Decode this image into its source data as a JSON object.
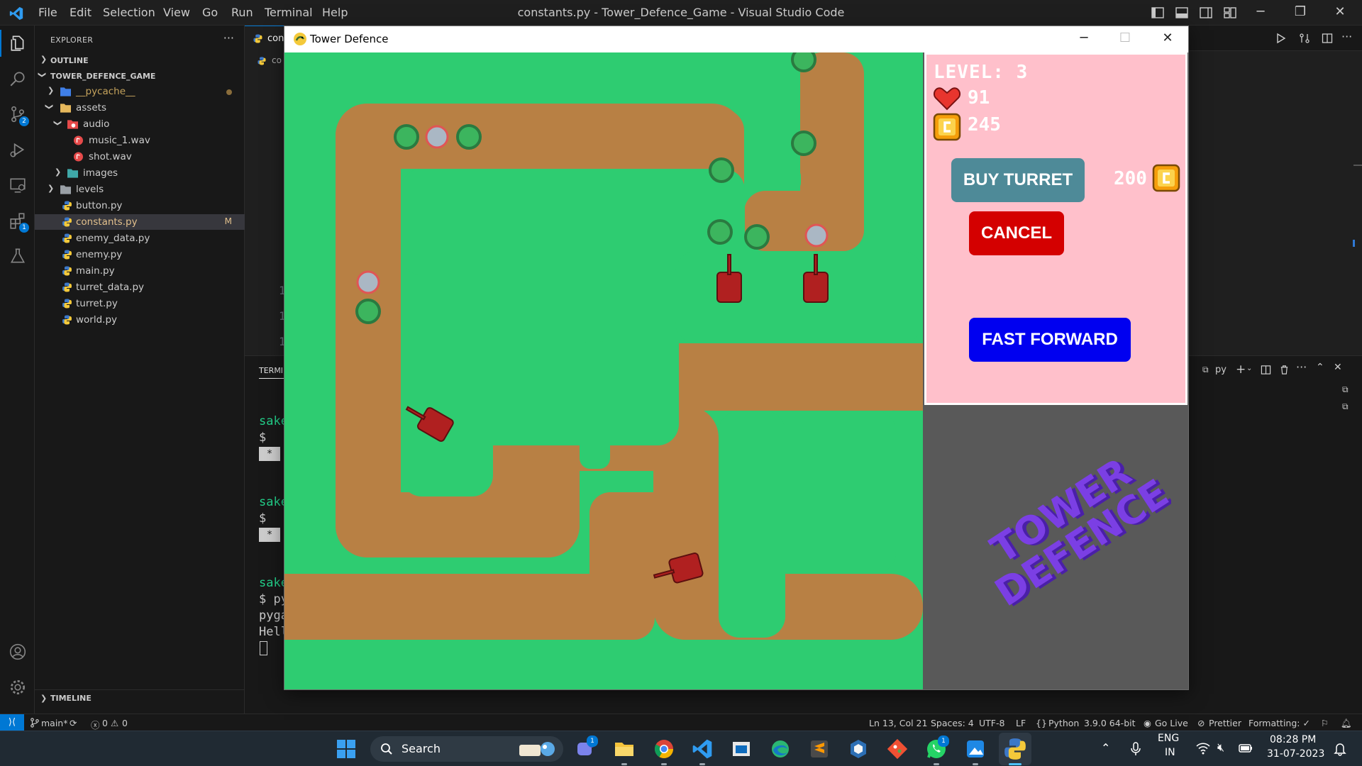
{
  "vscode": {
    "menu": [
      "File",
      "Edit",
      "Selection",
      "View",
      "Go",
      "Run",
      "Terminal",
      "Help"
    ],
    "window_title": "constants.py - Tower_Defence_Game - Visual Studio Code",
    "explorer": {
      "title": "EXPLORER",
      "outline": "OUTLINE",
      "project": "TOWER_DEFENCE_GAME",
      "timeline": "TIMELINE",
      "items": [
        {
          "label": "__pycache__",
          "type": "folder",
          "modified": true
        },
        {
          "label": "assets",
          "type": "folder"
        },
        {
          "label": "audio",
          "type": "folder"
        },
        {
          "label": "music_1.wav",
          "type": "audio"
        },
        {
          "label": "shot.wav",
          "type": "audio"
        },
        {
          "label": "images",
          "type": "folder"
        },
        {
          "label": "levels",
          "type": "folder"
        },
        {
          "label": "button.py",
          "type": "python"
        },
        {
          "label": "constants.py",
          "type": "python",
          "status": "M"
        },
        {
          "label": "enemy_data.py",
          "type": "python"
        },
        {
          "label": "enemy.py",
          "type": "python"
        },
        {
          "label": "main.py",
          "type": "python"
        },
        {
          "label": "turret_data.py",
          "type": "python"
        },
        {
          "label": "turret.py",
          "type": "python"
        },
        {
          "label": "world.py",
          "type": "python"
        }
      ]
    },
    "activity_badges": {
      "source_control": "2",
      "extensions": "1"
    },
    "editor": {
      "tab_fragment": "con",
      "breadcrumb_fragment": "co",
      "line_fragments": [
        "1",
        "1",
        "1"
      ]
    },
    "panel": {
      "tab": "TERMIN",
      "shell_label": "py",
      "lines": [
        {
          "text": "sake",
          "style": "green"
        },
        {
          "text": "$",
          "style": "plain"
        },
        {
          "text": "*",
          "style": "box"
        },
        {
          "text": "sake",
          "style": "green"
        },
        {
          "text": "$",
          "style": "plain"
        },
        {
          "text": "*",
          "style": "box"
        },
        {
          "text": "sake",
          "style": "green"
        },
        {
          "text": "$ py",
          "style": "plain"
        },
        {
          "text": "pyga",
          "style": "plain"
        },
        {
          "text": "Hell",
          "style": "plain"
        }
      ]
    },
    "status": {
      "branch": "main*",
      "problems": "0",
      "warnings": "0",
      "position": "Ln 13, Col 21",
      "spaces": "Spaces: 4",
      "encoding": "UTF-8",
      "eol": "LF",
      "language": "Python",
      "interpreter": "3.9.0 64-bit",
      "go_live": "Go Live",
      "prettier": "Prettier",
      "formatting": "Formatting: ✓"
    }
  },
  "game": {
    "window_title": "Tower Defence",
    "level_text": "LEVEL: 3",
    "health": "91",
    "money": "245",
    "buy_label": "BUY TURRET",
    "turret_price": "200",
    "cancel_label": "CANCEL",
    "fast_forward_label": "FAST FORWARD",
    "logo_line1": "TOWER",
    "logo_line2": "DEFENCE",
    "colors": {
      "grass": "#2ecc71",
      "path": "#b88044",
      "panel": "#ffc0cb",
      "buy": "#4e8a98",
      "cancel": "#d40000",
      "fast_forward": "#0000f0",
      "logo": "#7b3fe4"
    }
  },
  "taskbar": {
    "search": "Search",
    "language": "ENG",
    "region": "IN",
    "time": "08:28 PM",
    "date": "31-07-2023",
    "teams_badge": "1",
    "whatsapp_badge": "1"
  }
}
